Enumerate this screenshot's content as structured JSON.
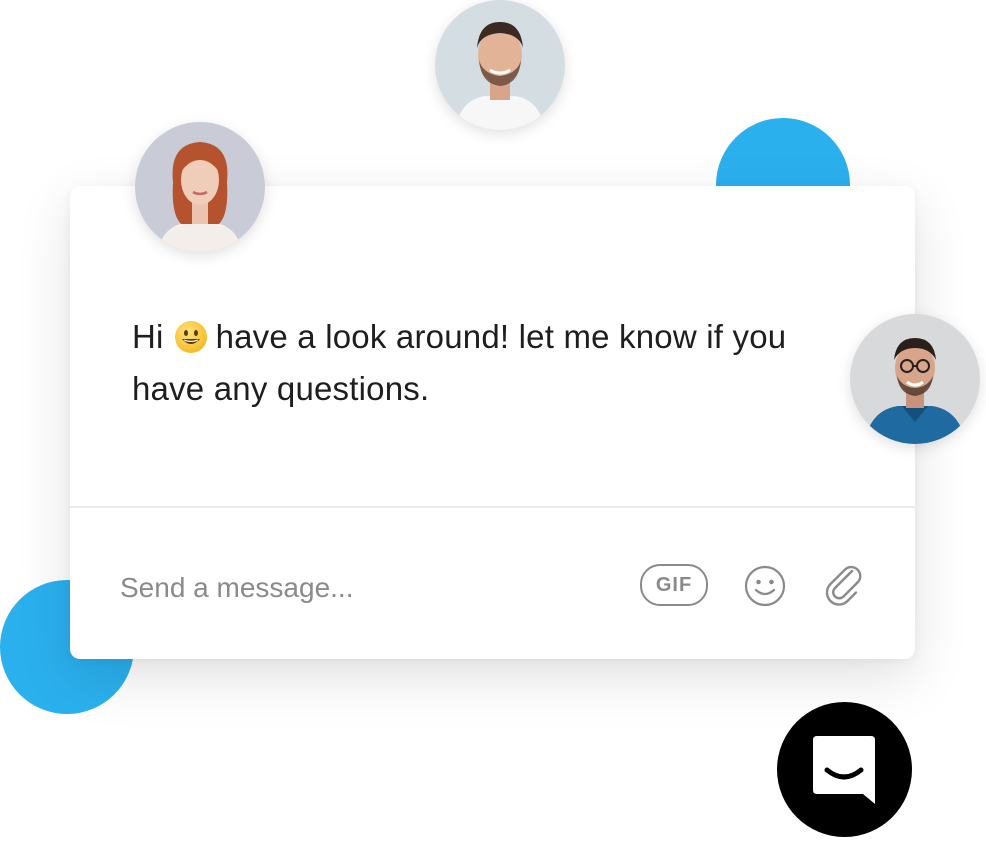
{
  "chat": {
    "greeting_pre": "Hi",
    "greeting_post": "have a look around! let me know if you have any questions.",
    "emoji": "grinning-face-icon"
  },
  "composer": {
    "placeholder": "Send a message...",
    "gif_label": "GIF",
    "emoji_icon": "smiley-icon",
    "attach_icon": "paperclip-icon"
  },
  "colors": {
    "accent_blue": "#2bb0ee",
    "launcher_bg": "#000000",
    "text": "#1e1e1e",
    "placeholder": "#8a8a8a"
  },
  "avatars": [
    "man-beard-avatar",
    "woman-red-hair-avatar",
    "man-glasses-avatar"
  ],
  "launcher": {
    "icon": "chat-bubble-smile-icon"
  }
}
